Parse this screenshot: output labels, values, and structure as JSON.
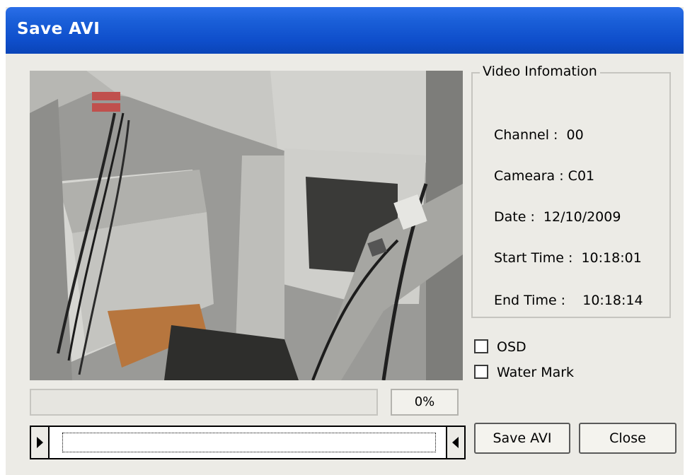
{
  "window": {
    "title": "Save AVI"
  },
  "video_info": {
    "group_label": "Video Infomation",
    "channel": "Channel :  00",
    "camera": "Cameara : C01",
    "date": "Date :  12/10/2009",
    "start_time": "Start Time :  10:18:01",
    "end_time": "End Time :    10:18:14"
  },
  "options": {
    "osd_label": "OSD",
    "osd_checked": false,
    "watermark_label": "Water Mark",
    "watermark_checked": false
  },
  "progress": {
    "percent_text": "0%",
    "value": 0
  },
  "buttons": {
    "save_label": "Save AVI",
    "close_label": "Close"
  },
  "icons": {
    "slider_left": "play-right-icon",
    "slider_right": "play-left-icon"
  }
}
